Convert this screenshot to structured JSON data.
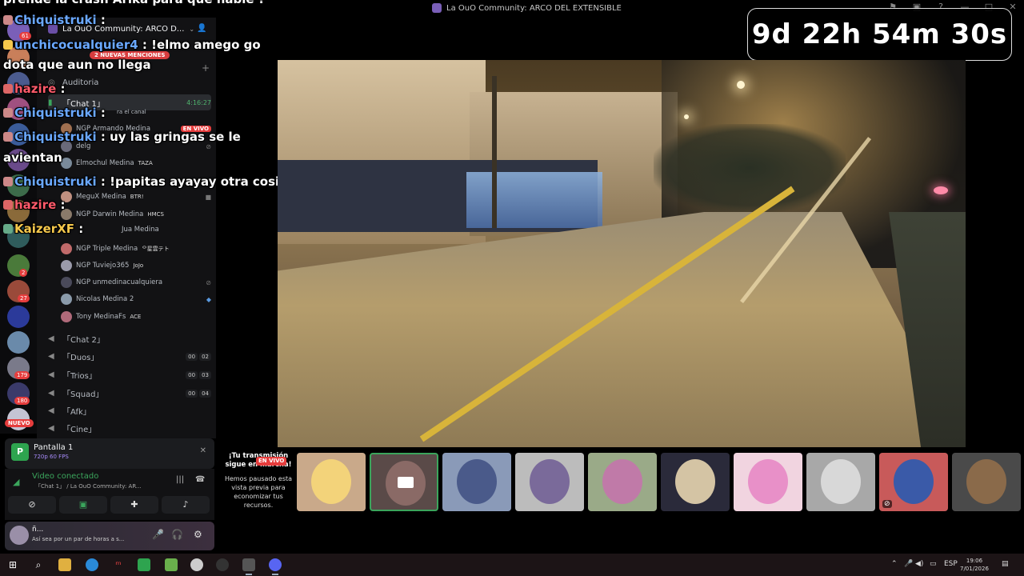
{
  "window": {
    "title": "La OuO Community: ARCO DEL EXTENSIBLE"
  },
  "countdown": "9d 22h 54m 30s",
  "server": {
    "name": "La OuO Community: ARCO D...",
    "mentions_pill": "2 NUEVAS MENCIONES"
  },
  "rail_badges": [
    "61",
    "2",
    "27",
    "179",
    "180"
  ],
  "rail_new": "NUEVO",
  "channels": [
    {
      "label": "Auditoria"
    },
    {
      "label": "「Chat 1」",
      "time": "4:16:27",
      "sub": "ra el canal"
    },
    {
      "label": "「Chat 2」"
    },
    {
      "label": "「Duos」",
      "counts": [
        "00",
        "02"
      ]
    },
    {
      "label": "「Trios」",
      "counts": [
        "00",
        "03"
      ]
    },
    {
      "label": "「Squad」",
      "counts": [
        "00",
        "04"
      ]
    },
    {
      "label": "「Afk」"
    },
    {
      "label": "「Cine」"
    }
  ],
  "voice_users": [
    {
      "name": "NGP Armando Medina",
      "live": "EN VIVO"
    },
    {
      "name": "delg"
    },
    {
      "name": "Elmochul Medina",
      "tag": "TAZA"
    },
    {
      "name": "MeguX Medina",
      "tag": "BTR!"
    },
    {
      "name": "NGP Darwin Medina",
      "tag": "HMCS"
    },
    {
      "name": "Jua Medina"
    },
    {
      "name": "NGP Triple Medina",
      "tag": "ᄋ星雲テト"
    },
    {
      "name": "NGP Tuviejo365",
      "tag": "JoJo"
    },
    {
      "name": "NGP unmedinacualquiera"
    },
    {
      "name": "Nicolas Medina 2"
    },
    {
      "name": "Tony MedinaFs",
      "tag": "ACE"
    }
  ],
  "chat_lines": [
    {
      "text": "prende la crash Arika para que hable ?"
    },
    {
      "nick": "Chiquistruki",
      "text": " : "
    },
    {
      "nick": "unchicocualquier4",
      "text": " : !elmo amego go"
    },
    {
      "text": "dota que aun no llega"
    },
    {
      "nick": "hazire",
      "text": " : "
    },
    {
      "nick": "Chiquistruki",
      "text": " : "
    },
    {
      "nick": "Chiquistruki",
      "text": " : uy las gringas se le"
    },
    {
      "text": "avientan"
    },
    {
      "nick": "Chiquistruki",
      "text": " : !papitas ayayay otra cosita"
    },
    {
      "nick": "hazire",
      "text": " : "
    },
    {
      "nick": "KaizerXF",
      "text": " : "
    }
  ],
  "share_panel": {
    "name": "Pantalla 1",
    "quality": "720p 60 FPS"
  },
  "voice_panel": {
    "status": "Video conectado",
    "channel": "「Chat 1」 / La OuO Community: AR..."
  },
  "user_panel": {
    "name": "ñ...",
    "status": "Así sea por un par de horas a s..."
  },
  "stream_notice": {
    "heading": "¡Tu transmisión sigue en marcha!",
    "live": "EN VIVO",
    "body": "Hemos pausado esta vista previa para economizar tus recursos."
  },
  "taskbar": {
    "lang": "ESP",
    "time": "19:06",
    "date": "7/01/2026"
  },
  "colors": {
    "accent_green": "#3ba55c",
    "live_red": "#e63d3d",
    "nick_blue": "#6aa8ff",
    "nick_red": "#ff5a6a",
    "nick_gold": "#f5c84c"
  }
}
